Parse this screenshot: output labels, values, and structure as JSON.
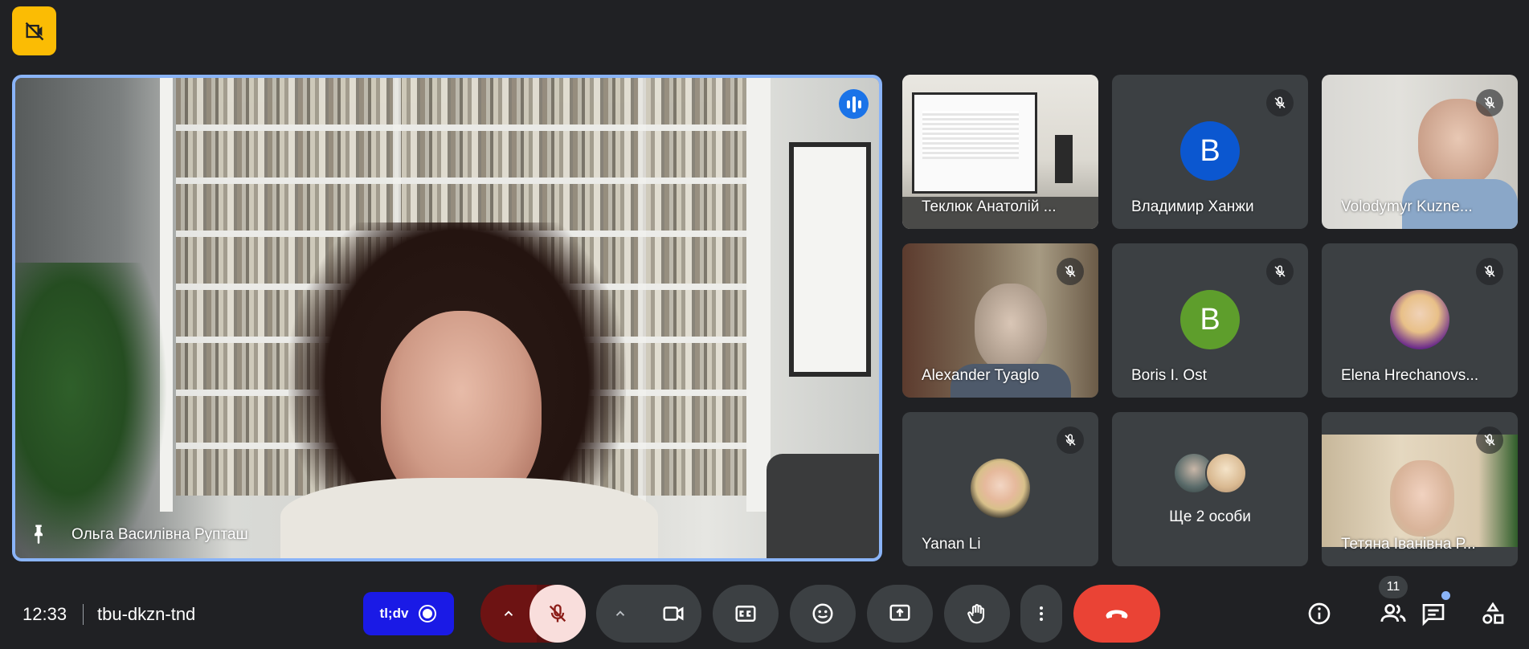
{
  "colors": {
    "background": "#202124",
    "accent": "#8ab4f8",
    "end_call": "#ea4335",
    "badge": "#fbbc04",
    "tldv": "#1a1ae6"
  },
  "top_badge": {
    "icon": "no-recording-icon"
  },
  "main_speaker": {
    "name": "Ольга Василівна Рупташ",
    "speaking": true,
    "pinned": true
  },
  "participants": [
    {
      "name": "Теклюк Анатолій ...",
      "muted": false,
      "type": "video"
    },
    {
      "name": "Владимир Ханжи",
      "muted": true,
      "type": "initial",
      "initial": "B",
      "avatar_color": "#0b57d0"
    },
    {
      "name": "Volodymyr Kuzne...",
      "muted": true,
      "type": "video"
    },
    {
      "name": "Alexander Tyaglo",
      "muted": true,
      "type": "video"
    },
    {
      "name": "Boris I. Ost",
      "muted": true,
      "type": "initial",
      "initial": "B",
      "avatar_color": "#5e9e2c"
    },
    {
      "name": "Elena Hrechanovs...",
      "muted": true,
      "type": "photo"
    },
    {
      "name": "Yanan Li",
      "muted": true,
      "type": "photo"
    },
    {
      "name": "Ще 2 особи",
      "muted": false,
      "type": "group"
    },
    {
      "name": "Тетяна Іванівна Р...",
      "muted": true,
      "type": "video"
    }
  ],
  "footer": {
    "time": "12:33",
    "meeting_code": "tbu-dkzn-tnd",
    "tldv_label": "tl;dv",
    "people_count": "11"
  }
}
